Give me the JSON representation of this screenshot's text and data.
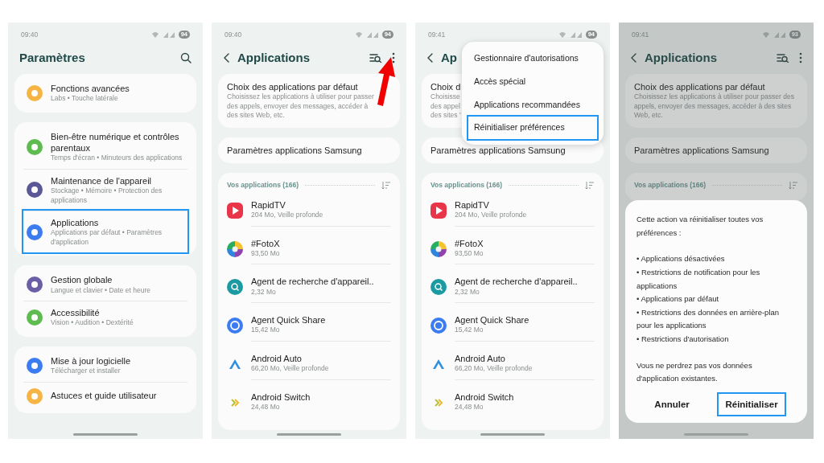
{
  "screens": [
    {
      "kind": "settings",
      "time": "09:40",
      "battery": "94",
      "title": "Paramètres",
      "groups": [
        {
          "items": [
            {
              "title": "Fonctions avancées",
              "subtitle": "Labs  •  Touche latérale",
              "color": "#f6b445",
              "highlighted": false
            }
          ]
        },
        {
          "items": [
            {
              "title": "Bien-être numérique et contrôles parentaux",
              "subtitle": "Temps d'écran  •  Minuteurs des applications",
              "color": "#5dbb4f",
              "highlighted": false
            },
            {
              "title": "Maintenance de l'appareil",
              "subtitle": "Stockage  •  Mémoire  •  Protection des applications",
              "color": "#5b5896",
              "highlighted": false
            },
            {
              "title": "Applications",
              "subtitle": "Applications par défaut  •  Paramètres d'application",
              "color": "#3b7cf0",
              "highlighted": true
            }
          ]
        },
        {
          "items": [
            {
              "title": "Gestion globale",
              "subtitle": "Langue et clavier  •  Date et heure",
              "color": "#6a5fa6",
              "highlighted": false
            },
            {
              "title": "Accessibilité",
              "subtitle": "Vision  •  Audition  •  Dextérité",
              "color": "#5dbb4f",
              "highlighted": false
            }
          ]
        },
        {
          "items": [
            {
              "title": "Mise à jour logicielle",
              "subtitle": "Télécharger et installer",
              "color": "#3b7cf0",
              "highlighted": false
            },
            {
              "title": "Astuces et guide utilisateur",
              "color": "#f6b445",
              "highlighted": false
            }
          ]
        }
      ]
    },
    {
      "kind": "apps",
      "time": "09:40",
      "battery": "94",
      "title": "Applications",
      "pointer_arrow": true,
      "default_card": {
        "title": "Choix des applications par défaut",
        "desc": "Choisissez les applications à utiliser pour passer des appels, envoyer des messages, accéder à des sites Web, etc."
      },
      "samsung_card": "Paramètres applications Samsung",
      "section": "Vos applications (166)",
      "apps": [
        {
          "name": "RapidTV",
          "detail": "204 Mo, Veille profonde",
          "kind": "play"
        },
        {
          "name": "#FotoX",
          "detail": "93,50 Mo",
          "kind": "wheel"
        },
        {
          "name": "Agent de recherche d'appareil..",
          "detail": "2,32 Mo",
          "kind": "magnifier"
        },
        {
          "name": "Agent Quick Share",
          "detail": "15,42 Mo",
          "kind": "sync"
        },
        {
          "name": "Android Auto",
          "detail": "66,20 Mo, Veille profonde",
          "kind": "chevron"
        },
        {
          "name": "Android Switch",
          "detail": "24,48 Mo",
          "kind": "double-chevron"
        }
      ]
    },
    {
      "kind": "apps",
      "time": "09:41",
      "battery": "94",
      "title": "Ap",
      "default_card": {
        "title": "Choix d",
        "desc_lines": [
          "Choisisse",
          "des appel",
          "des sites '"
        ]
      },
      "samsung_card": "Paramètres applications Samsung",
      "section": "Vos applications (166)",
      "apps": [
        {
          "name": "RapidTV",
          "detail": "204 Mo, Veille profonde",
          "kind": "play"
        },
        {
          "name": "#FotoX",
          "detail": "93,50 Mo",
          "kind": "wheel"
        },
        {
          "name": "Agent de recherche d'appareil..",
          "detail": "2,32 Mo",
          "kind": "magnifier"
        },
        {
          "name": "Agent Quick Share",
          "detail": "15,42 Mo",
          "kind": "sync"
        },
        {
          "name": "Android Auto",
          "detail": "66,20 Mo, Veille profonde",
          "kind": "chevron"
        },
        {
          "name": "Android Switch",
          "detail": "24,48 Mo",
          "kind": "double-chevron"
        }
      ],
      "menu": [
        {
          "label": "Gestionnaire d'autorisations",
          "highlighted": false
        },
        {
          "label": "Accès spécial",
          "highlighted": false
        },
        {
          "label": "Applications recommandées",
          "highlighted": false
        },
        {
          "label": "Réinitialiser préférences",
          "highlighted": true
        }
      ]
    },
    {
      "kind": "apps",
      "time": "09:41",
      "battery": "93",
      "title": "Applications",
      "dimmed": true,
      "default_card": {
        "title": "Choix des applications par défaut",
        "desc": "Choisissez les applications à utiliser pour passer des appels, envoyer des messages, accéder à des sites Web, etc."
      },
      "samsung_card": "Paramètres applications Samsung",
      "section": "Vos applications (166)",
      "dialog": {
        "intro": "Cette action va réinitialiser toutes vos préférences :",
        "bullets": [
          "• Applications désactivées",
          "• Restrictions de notification pour les applications",
          "• Applications par défaut",
          "• Restrictions des données en arrière-plan pour les applications",
          "• Restrictions d'autorisation"
        ],
        "note": "Vous ne perdrez pas vos données d'application existantes.",
        "buttons": [
          {
            "label": "Annuler",
            "highlighted": false
          },
          {
            "label": "Réinitialiser",
            "highlighted": true
          }
        ]
      }
    }
  ]
}
